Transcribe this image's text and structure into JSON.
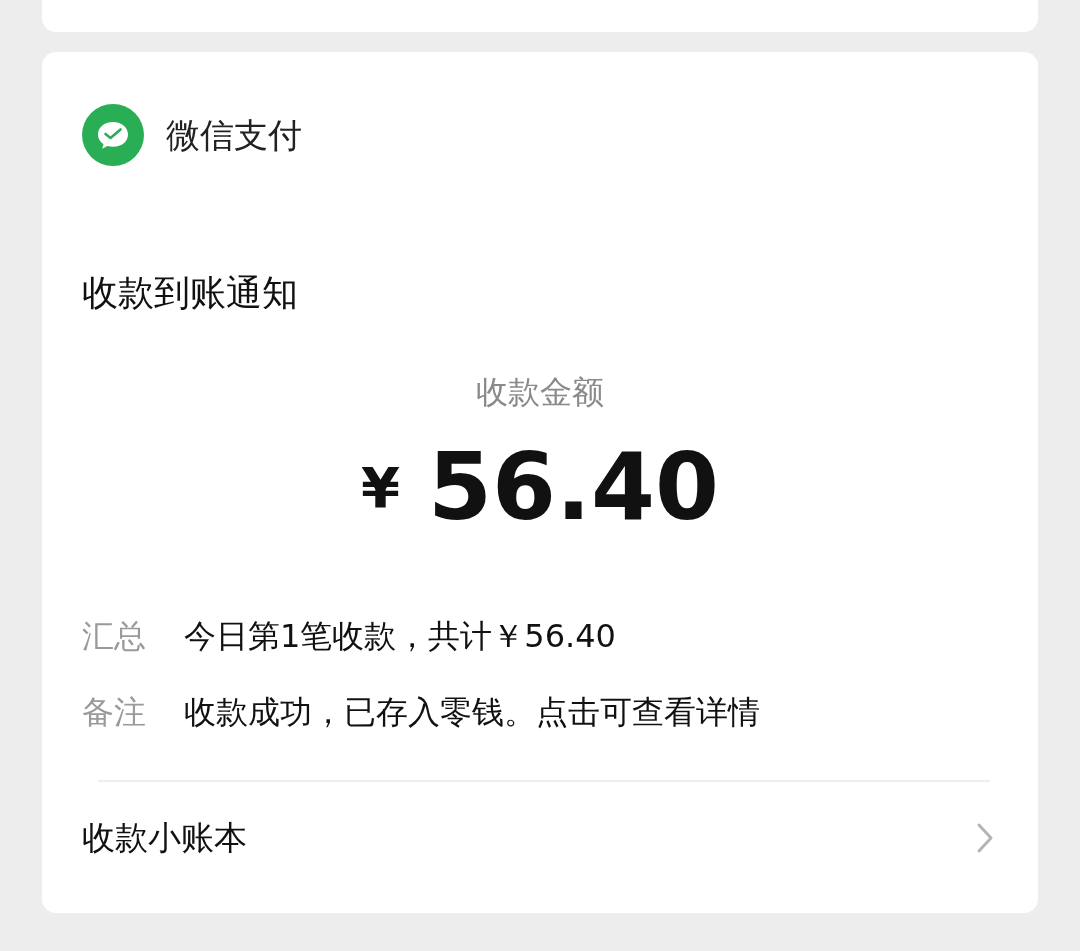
{
  "app": {
    "name": "微信支付"
  },
  "notice": {
    "title": "收款到账通知",
    "amount_label": "收款金额",
    "currency": "¥",
    "amount": "56.40",
    "details": [
      {
        "label": "汇总",
        "value": "今日第1笔收款，共计￥56.40"
      },
      {
        "label": "备注",
        "value": "收款成功，已存入零钱。点击可查看详情"
      }
    ]
  },
  "footer": {
    "label": "收款小账本"
  }
}
